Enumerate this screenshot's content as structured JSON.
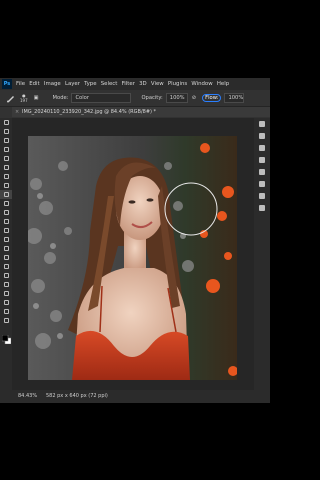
{
  "app": {
    "logo": "Ps"
  },
  "menu": [
    "File",
    "Edit",
    "Image",
    "Layer",
    "Type",
    "Select",
    "Filter",
    "3D",
    "View",
    "Plugins",
    "Window",
    "Help"
  ],
  "options": {
    "brush_size": "197",
    "mode_label": "Mode:",
    "mode_value": "Color",
    "opacity_label": "Opacity:",
    "opacity_value": "100%",
    "flow_label": "Flow:",
    "flow_value": "100%"
  },
  "document": {
    "tab_title": "IMG_20240110_233920_342.jpg @ 84.4% (RGB/8#) *",
    "close": "×"
  },
  "status": {
    "zoom": "84.43%",
    "dimensions": "582 px x 640 px (72 ppi)"
  },
  "colors": {
    "accent": "#2a7fff",
    "dress": "#c83a1f",
    "flowers": "#e8561e"
  }
}
